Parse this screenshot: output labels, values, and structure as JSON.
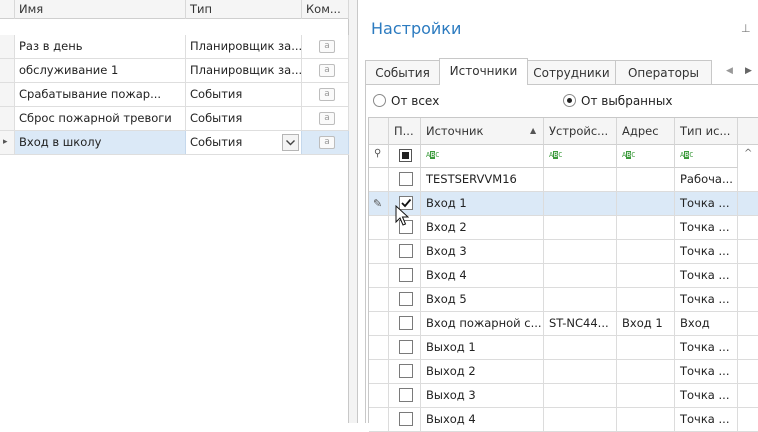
{
  "left_grid": {
    "columns": [
      "Имя",
      "Тип",
      "Ком..."
    ],
    "rows": [
      {
        "name": "Раз в день",
        "type": "Планировщик за...",
        "comment": "a"
      },
      {
        "name": "обслуживание 1",
        "type": "Планировщик за...",
        "comment": "a"
      },
      {
        "name": "Срабатывание пожар...",
        "type": "События",
        "comment": "a"
      },
      {
        "name": "Сброс пожарной тревоги",
        "type": "События",
        "comment": "a"
      },
      {
        "name": "Вход в школу",
        "type": "События",
        "comment": "a"
      }
    ],
    "current_row_marker": "▸"
  },
  "panel": {
    "title": "Настройки",
    "pin_glyph": "⊥",
    "tabs": [
      "События",
      "Источники",
      "Сотрудники",
      "Операторы"
    ],
    "active_tab": "Источники",
    "tab_prev_glyph": "◀",
    "tab_next_glyph": "▶",
    "radio_all": "От всех",
    "radio_selected": "От выбранных",
    "radio_checked": "От выбранных"
  },
  "source_grid": {
    "columns": [
      "П...",
      "Источник",
      "Устройс...",
      "Адрес",
      "Тип ис..."
    ],
    "sort_glyph": "▲",
    "filter_pin_glyph": "⚲",
    "filter_abc": [
      "A",
      "B",
      "C"
    ],
    "scroll_up_glyph": "^",
    "edit_row_glyph": "✎",
    "rows": [
      {
        "checked": false,
        "source": "TESTSERVVM16",
        "device": "",
        "address": "",
        "type": "Рабоча..."
      },
      {
        "checked": true,
        "source": "Вход 1",
        "device": "",
        "address": "",
        "type": "Точка ..."
      },
      {
        "checked": false,
        "source": "Вход 2",
        "device": "",
        "address": "",
        "type": "Точка ..."
      },
      {
        "checked": false,
        "source": "Вход 3",
        "device": "",
        "address": "",
        "type": "Точка ..."
      },
      {
        "checked": false,
        "source": "Вход 4",
        "device": "",
        "address": "",
        "type": "Точка ..."
      },
      {
        "checked": false,
        "source": "Вход 5",
        "device": "",
        "address": "",
        "type": "Точка ..."
      },
      {
        "checked": false,
        "source": "Вход пожарной с...",
        "device": "ST-NC44...",
        "address": "Вход 1",
        "type": "Вход"
      },
      {
        "checked": false,
        "source": "Выход 1",
        "device": "",
        "address": "",
        "type": "Точка ..."
      },
      {
        "checked": false,
        "source": "Выход 2",
        "device": "",
        "address": "",
        "type": "Точка ..."
      },
      {
        "checked": false,
        "source": "Выход 3",
        "device": "",
        "address": "",
        "type": "Точка ..."
      },
      {
        "checked": false,
        "source": "Выход 4",
        "device": "",
        "address": "",
        "type": "Точка ..."
      }
    ]
  },
  "colors": {
    "accent": "#2c7bc0",
    "selection": "#dbe9f7",
    "grid_line": "#dcdcdc",
    "header_bg": "#f5f5f5"
  }
}
